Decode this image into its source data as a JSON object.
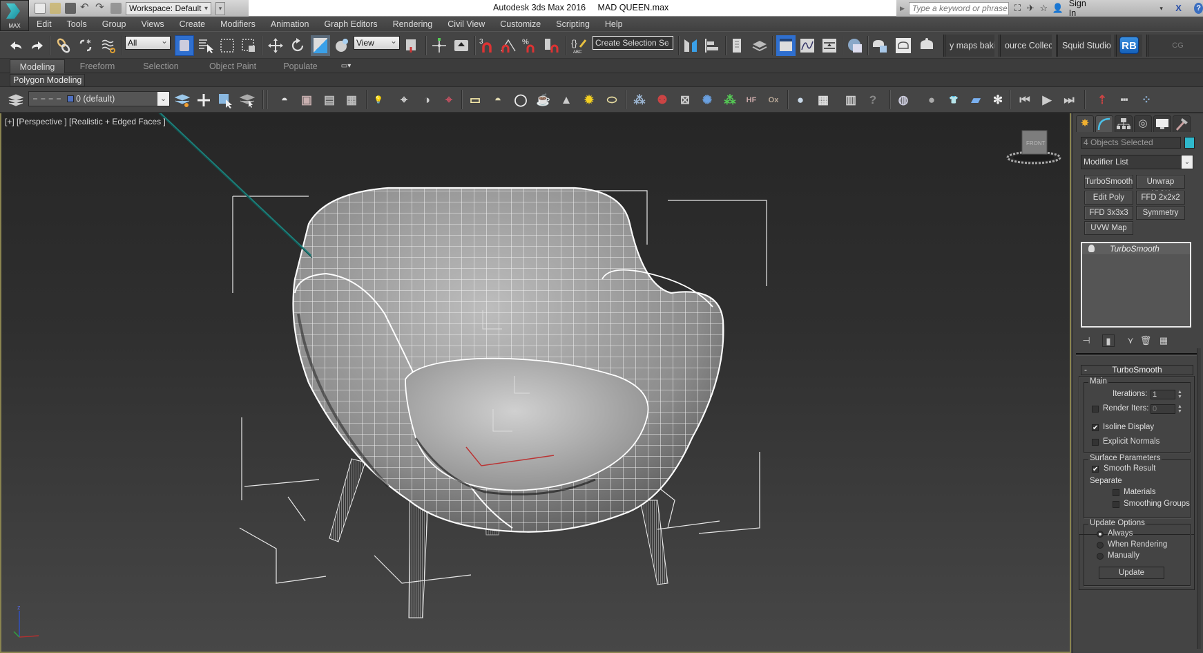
{
  "title_bar": {
    "app_logo_label": "MAX",
    "workspace": "Workspace: Default",
    "title": "Autodesk 3ds Max 2016     MAD QUEEN.max",
    "search_placeholder": "Type a keyword or phrase",
    "sign_in": "Sign In",
    "icons": [
      "new-file-icon",
      "open-file-icon",
      "save-icon",
      "undo-icon",
      "redo-icon",
      "project-folder-icon"
    ],
    "right_icons": [
      "binoculars-icon",
      "satellite-icon",
      "star-icon",
      "user-icon",
      "exchange-x-icon",
      "help-icon"
    ]
  },
  "menu": [
    "Edit",
    "Tools",
    "Group",
    "Views",
    "Create",
    "Modifiers",
    "Animation",
    "Graph Editors",
    "Rendering",
    "Civil View",
    "Customize",
    "Scripting",
    "Help"
  ],
  "main_toolbar": {
    "selection_filter": "All",
    "ref_coord": "View",
    "named_selection_placeholder": "Create Selection Se",
    "custom_buttons": [
      "y maps baking",
      "ource Collectc",
      "Squid Studio v"
    ],
    "rb_label": "RB",
    "cg_label": "CG"
  },
  "ribbon": {
    "tabs": [
      "Modeling",
      "Freeform",
      "Selection",
      "Object Paint",
      "Populate"
    ],
    "active_tab": "Modeling",
    "panel": "Polygon Modeling"
  },
  "layer_toolbar": {
    "current_layer": "0 (default)"
  },
  "viewport": {
    "label": "[+] [Perspective ] [Realistic + Edged Faces ]",
    "viewcube_face": "FRONT",
    "axis_label": "z"
  },
  "command_panel": {
    "selection_name": "4 Objects Selected",
    "object_color": "#2fb8cc",
    "modifier_list": "Modifier List",
    "modifier_buttons": [
      "TurboSmooth",
      "Unwrap UVW",
      "Edit Poly",
      "FFD 2x2x2",
      "FFD 3x3x3",
      "Symmetry",
      "UVW Map"
    ],
    "stack": [
      "TurboSmooth"
    ],
    "rollout": {
      "title": "TurboSmooth",
      "collapse": "-",
      "main_group": "Main",
      "iterations_label": "Iterations:",
      "iterations_value": "1",
      "render_iters_label": "Render Iters:",
      "render_iters_value": "0",
      "render_iters_checked": false,
      "isoline_label": "Isoline Display",
      "isoline_checked": true,
      "explicit_normals_label": "Explicit Normals",
      "explicit_normals_checked": false,
      "surface_group": "Surface Parameters",
      "smooth_result_label": "Smooth Result",
      "smooth_result_checked": true,
      "separate_label": "Separate",
      "materials_label": "Materials",
      "smoothing_groups_label": "Smoothing Groups",
      "update_group": "Update Options",
      "update_options": [
        "Always",
        "When Rendering",
        "Manually"
      ],
      "update_selected": "Always",
      "update_button": "Update"
    }
  }
}
